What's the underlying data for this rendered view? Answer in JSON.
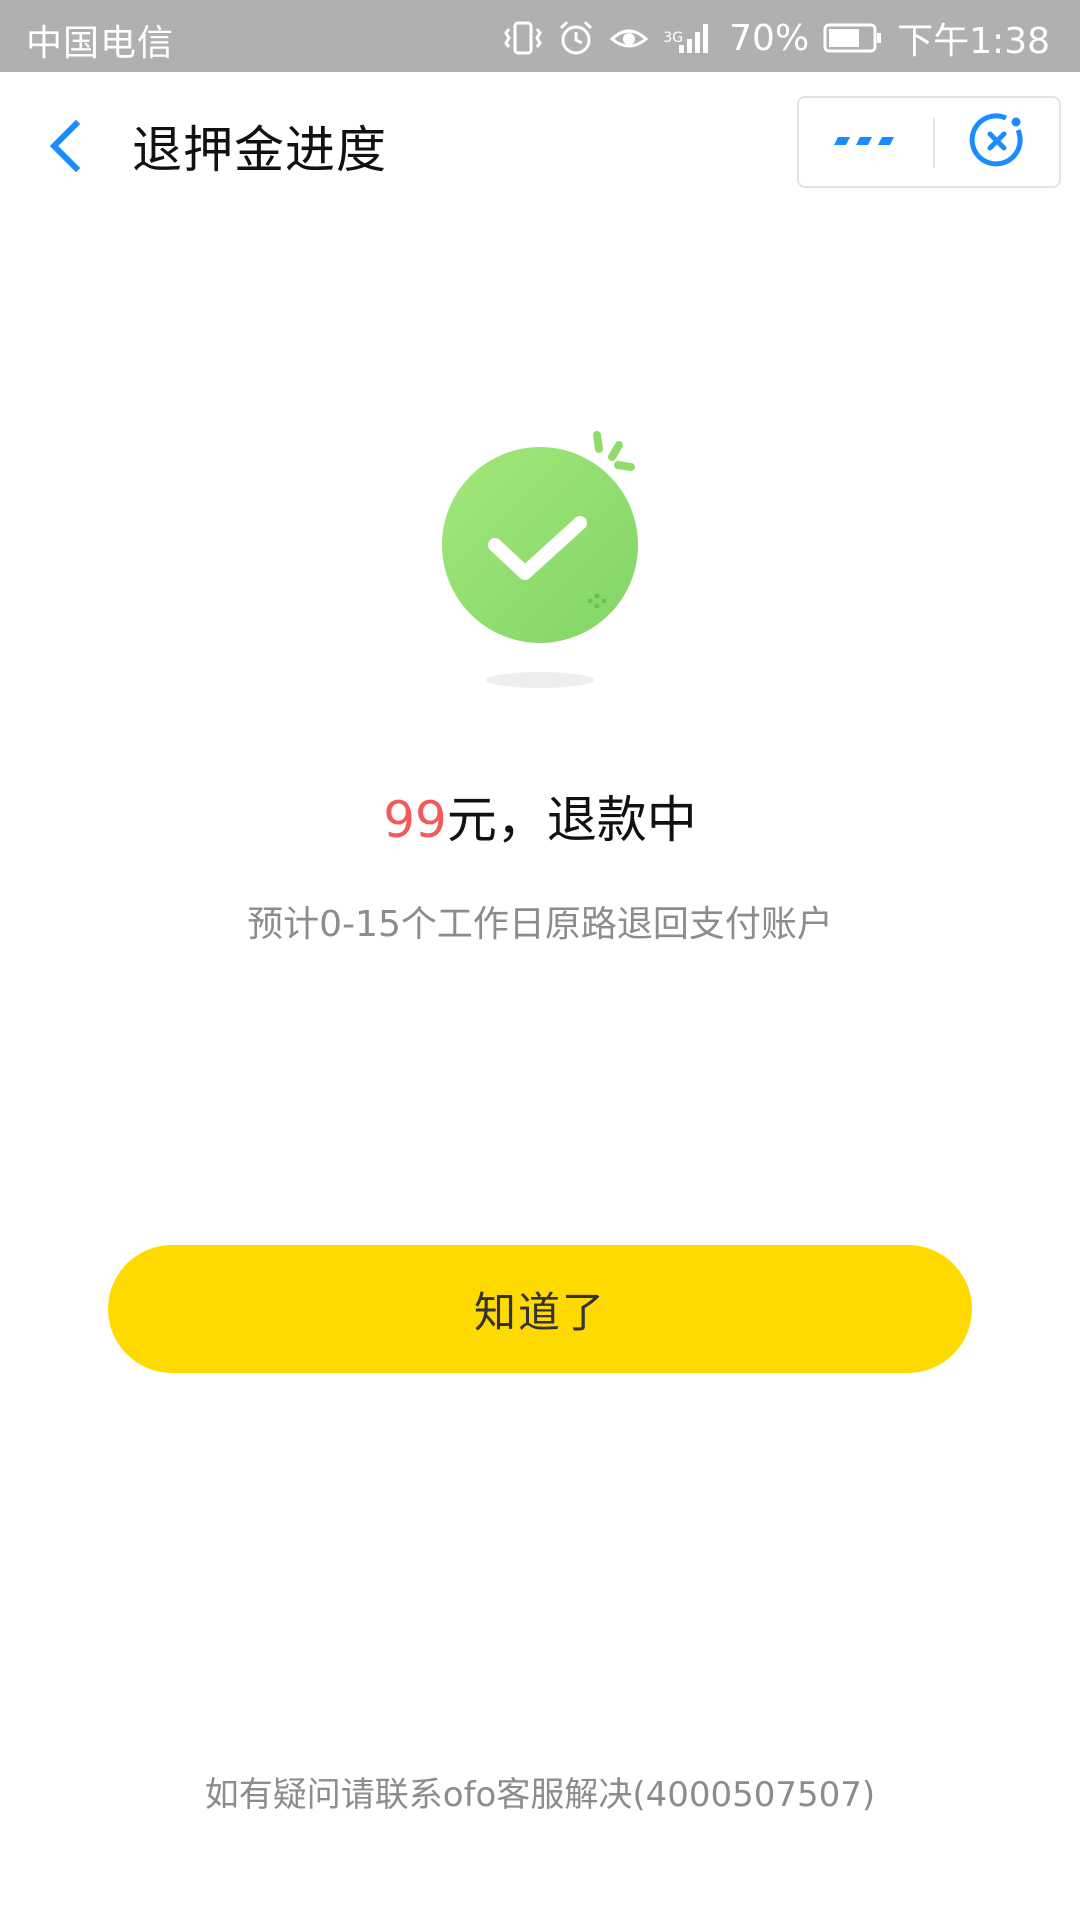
{
  "status_bar": {
    "carrier": "中国电信",
    "network": "3G",
    "battery": "70%",
    "time": "下午1:38",
    "icons": [
      "vibrate-icon",
      "alarm-icon",
      "eye-icon",
      "signal-icon",
      "battery-icon"
    ]
  },
  "header": {
    "title": "退押金进度",
    "icons": [
      "back-arrow-icon",
      "more-dots-icon",
      "close-circle-icon"
    ],
    "accent_color": "#1a8cff"
  },
  "result": {
    "icon": "success-check-icon",
    "amount": "99",
    "amount_suffix": "元，退款中",
    "description": "预计0-15个工作日原路退回支付账户",
    "amount_color": "#f25a5a",
    "icon_color": "#8edc6a"
  },
  "actions": {
    "confirm_label": "知道了",
    "button_color": "#ffda00"
  },
  "footer": {
    "contact_text": "如有疑问请联系ofo客服解决(4000507507)"
  }
}
